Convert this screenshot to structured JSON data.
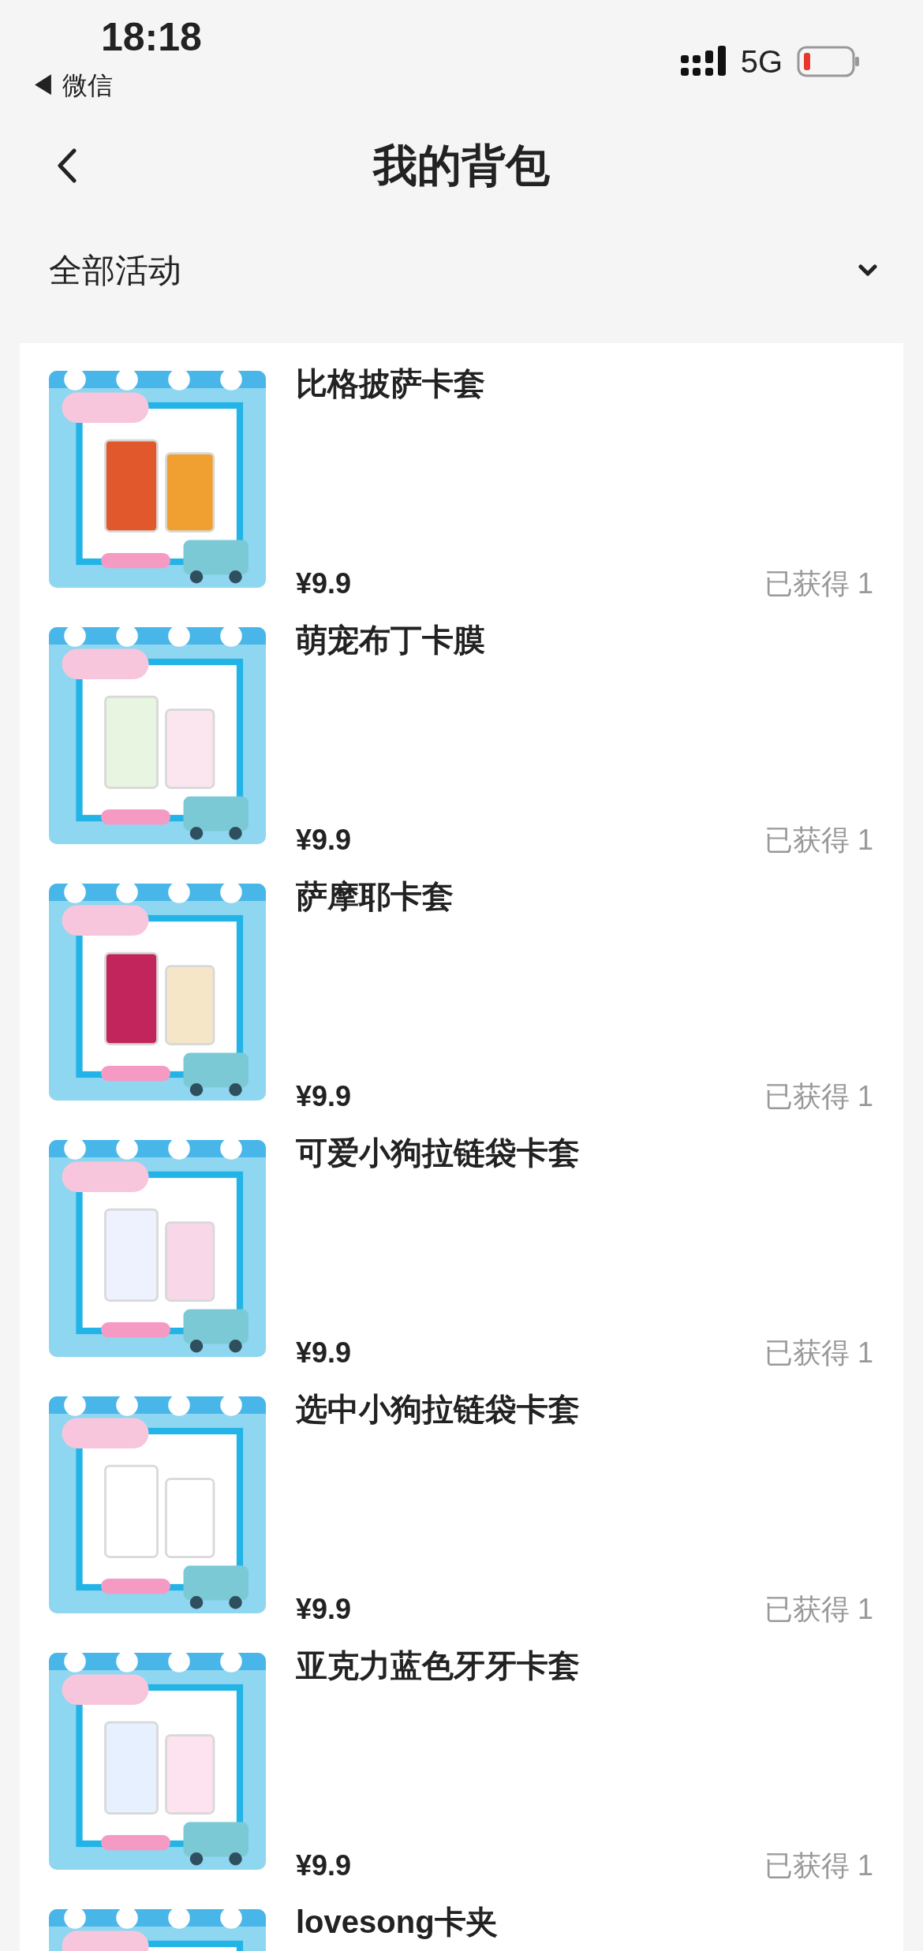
{
  "status_bar": {
    "time": "18:18",
    "back_app": "◀ 微信",
    "network": "5G"
  },
  "header": {
    "title": "我的背包"
  },
  "filter": {
    "label": "全部活动"
  },
  "items": [
    {
      "title": "比格披萨卡套",
      "price": "¥9.9",
      "obtained": "已获得 1"
    },
    {
      "title": "萌宠布丁卡膜",
      "price": "¥9.9",
      "obtained": "已获得 1"
    },
    {
      "title": "萨摩耶卡套",
      "price": "¥9.9",
      "obtained": "已获得 1"
    },
    {
      "title": "可爱小狗拉链袋卡套",
      "price": "¥9.9",
      "obtained": "已获得 1"
    },
    {
      "title": "选中小狗拉链袋卡套",
      "price": "¥9.9",
      "obtained": "已获得 1"
    },
    {
      "title": "亚克力蓝色牙牙卡套",
      "price": "¥9.9",
      "obtained": "已获得 1"
    },
    {
      "title": "lovesong卡夹"
    }
  ]
}
